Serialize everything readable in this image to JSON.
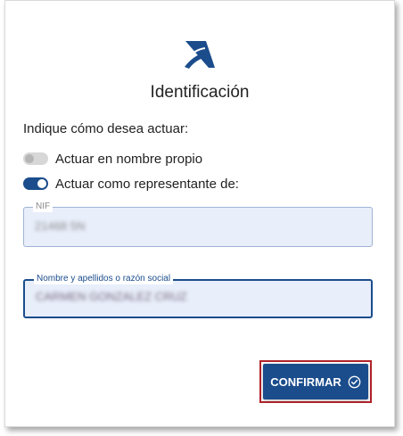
{
  "brand": {
    "logo_icon": "agencia-tributaria-logo",
    "accent_color": "#1b4d8c"
  },
  "dialog": {
    "title": "Identificación",
    "prompt": "Indique cómo desea actuar:"
  },
  "options": [
    {
      "label": "Actuar en nombre propio",
      "selected": false
    },
    {
      "label": "Actuar como representante de:",
      "selected": true
    }
  ],
  "fields": {
    "nif": {
      "label": "NIF",
      "value": "21468 5N"
    },
    "name": {
      "label": "Nombre y apellidos o razón social",
      "value": "CARMEN GONZALEZ CRUZ"
    }
  },
  "actions": {
    "confirm_label": "CONFIRMAR",
    "confirm_icon": "check-circle-icon"
  }
}
